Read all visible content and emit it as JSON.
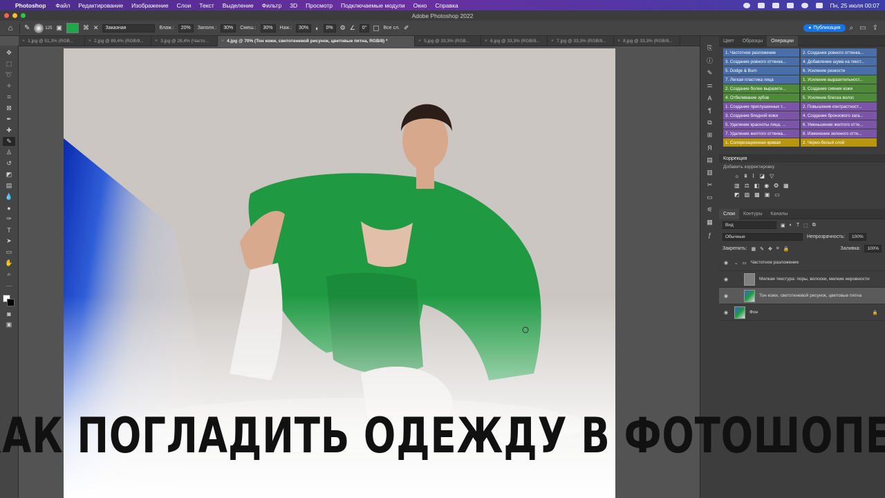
{
  "menubar": {
    "app": "Photoshop",
    "items": [
      "Файл",
      "Редактирование",
      "Изображение",
      "Слои",
      "Текст",
      "Выделение",
      "Фильтр",
      "3D",
      "Просмотр",
      "Подключаемые модули",
      "Окно",
      "Справка"
    ],
    "clock": "Пн, 25 июля  00:07"
  },
  "window": {
    "title": "Adobe Photoshop 2022"
  },
  "options": {
    "brush_size": "125",
    "preset": "Заказная",
    "flow_label": "Влаж.:",
    "flow": "20%",
    "fill_label": "Заполн.:",
    "fill": "30%",
    "mix_label": "Смеш.:",
    "mix": "30%",
    "press_label": "Наж.:",
    "press": "30%",
    "angle_pct": "0%",
    "angle": "0°",
    "all_layers": "Все сл.",
    "publish": "Публикация",
    "brush_color": "#1fa84a"
  },
  "tabs": [
    "1.jpg @ 51,3% (RGB...",
    "2.jpg @ 89,4% (RGB/8...",
    "3.jpg @ 28,4% (Часто...",
    "4.jpg @ 70% (Тон кожи, светотеневой рисунок, цветовые пятна, RGB/8) *",
    "5.jpg @ 33,3% (RGB...",
    "6.jpg @ 33,3% (RGB/8...",
    "7.jpg @ 33,3% (RGB/8...",
    "8.jpg @ 33,3% (RGB/8..."
  ],
  "panel_tabs": [
    "Цвет",
    "Образцы",
    "Операции"
  ],
  "actions": [
    {
      "label": "1. Частотное разложение",
      "color": "#4a6fa8"
    },
    {
      "label": "2. Создание ровного оттенка...",
      "color": "#4a6fa8"
    },
    {
      "label": "3. Создание ровного оттенка...",
      "color": "#4a6fa8"
    },
    {
      "label": "4. Добавление шума на текст...",
      "color": "#4a6fa8"
    },
    {
      "label": "5. Dodge & Burn",
      "color": "#4a6fa8"
    },
    {
      "label": "6. Усиление резкости",
      "color": "#4a6fa8"
    },
    {
      "label": "7. Легкая пластика лица",
      "color": "#4a6fa8"
    },
    {
      "label": "1. Усиление выразительност...",
      "color": "#4f8a3a"
    },
    {
      "label": "2. Создание более выразите...",
      "color": "#4f8a3a"
    },
    {
      "label": "3. Создание сияния кожи",
      "color": "#4f8a3a"
    },
    {
      "label": "4. Отбеливание зубов",
      "color": "#4f8a3a"
    },
    {
      "label": "5. Усиление блеска волос",
      "color": "#4f8a3a"
    },
    {
      "label": "1. Создание приглушенных т...",
      "color": "#7a55a8"
    },
    {
      "label": "2. Повышение контрастност...",
      "color": "#7a55a8"
    },
    {
      "label": "3. Создание бледной кожи",
      "color": "#7a55a8"
    },
    {
      "label": "4. Создание бронзового зага...",
      "color": "#7a55a8"
    },
    {
      "label": "5. Удаление красноты лица, ...",
      "color": "#7a55a8"
    },
    {
      "label": "6. Уменьшение желтого отте...",
      "color": "#7a55a8"
    },
    {
      "label": "7. Удаление желтого оттенка...",
      "color": "#7a55a8"
    },
    {
      "label": "8. Изменение зеленого отте...",
      "color": "#7a55a8"
    },
    {
      "label": "1. Соляризационная кривая",
      "color": "#b8960f"
    },
    {
      "label": "2. Черно-белый слой",
      "color": "#b8960f"
    }
  ],
  "correction": {
    "title": "Коррекция",
    "subtitle": "Добавить корректировку"
  },
  "layers_tabs": [
    "Слои",
    "Контуры",
    "Каналы"
  ],
  "layers_panel": {
    "search": "Вид",
    "blend": "Обычные",
    "opacity_label": "Непрозрачность:",
    "opacity": "100%",
    "lock_label": "Закрепить:",
    "fill_label": "Заливка:",
    "fill": "100%"
  },
  "layers": [
    {
      "name": "Частотное разложение"
    },
    {
      "name": "Мелкая текстура: поры, волоски, мелкие неровности"
    },
    {
      "name": "Тон кожи, светотеневой рисунок, цветовые пятна"
    },
    {
      "name": "Фон"
    }
  ],
  "headline": "КАК ПОГЛАДИТЬ ОДЕЖДУ В ФОТОШОПЕ?"
}
